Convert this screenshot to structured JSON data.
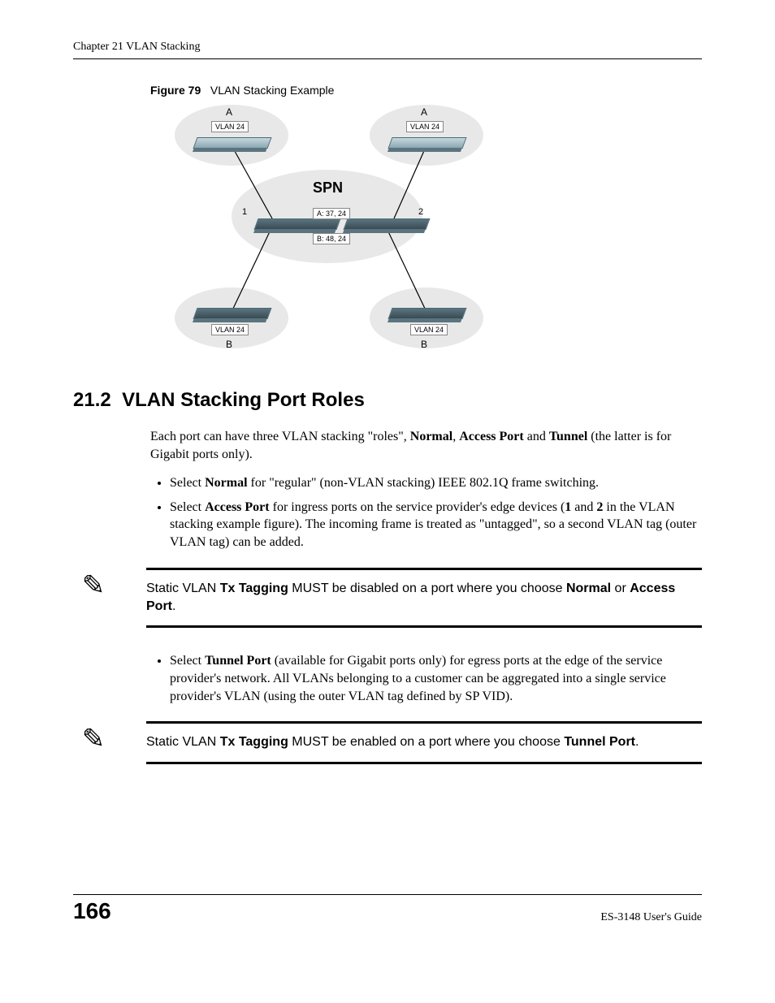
{
  "header": {
    "text": "Chapter 21 VLAN Stacking"
  },
  "figure": {
    "label": "Figure 79",
    "caption": "VLAN Stacking Example",
    "labels": {
      "spn": "SPN",
      "a_left": "A",
      "a_right": "A",
      "b_left": "B",
      "b_right": "B",
      "n1": "1",
      "n2": "2",
      "vlan_tl": "VLAN 24",
      "vlan_tr": "VLAN 24",
      "vlan_bl": "VLAN 24",
      "vlan_br": "VLAN 24",
      "mid_top": "A: 37, 24",
      "mid_bottom": "B: 48, 24"
    }
  },
  "section": {
    "number": "21.2",
    "title": "VLAN Stacking Port Roles",
    "intro_pre": "Each port can have three VLAN stacking \"roles\", ",
    "intro_b1": "Normal",
    "intro_mid1": ", ",
    "intro_b2": "Access Port",
    "intro_mid2": " and ",
    "intro_b3": "Tunnel",
    "intro_post": " (the latter is for Gigabit ports only).",
    "bullets1": {
      "b1_pre": "Select ",
      "b1_b": "Normal",
      "b1_post": " for \"regular\" (non-VLAN stacking) IEEE 802.1Q frame switching.",
      "b2_pre": "Select ",
      "b2_b": "Access Port",
      "b2_mid": " for ingress ports on the service provider's edge devices (",
      "b2_n1": "1",
      "b2_and": " and ",
      "b2_n2": "2",
      "b2_post": " in the VLAN stacking example figure). The incoming frame is treated as \"untagged\", so a second VLAN tag (outer VLAN tag) can be added."
    },
    "note1_pre": "Static VLAN ",
    "note1_b1": "Tx Tagging",
    "note1_mid1": " MUST be disabled on a port where you choose ",
    "note1_b2": "Normal",
    "note1_or": " or ",
    "note1_b3": "Access Port",
    "note1_post": ".",
    "bullets2": {
      "b3_pre": "Select ",
      "b3_b": "Tunnel Port",
      "b3_post": " (available for Gigabit ports only) for egress ports at the edge of the service provider's network. All VLANs belonging to a customer can be aggregated into a single service provider's VLAN (using the outer VLAN tag defined by SP VID)."
    },
    "note2_pre": "Static VLAN ",
    "note2_b1": "Tx Tagging",
    "note2_mid1": " MUST be enabled on a port where you choose ",
    "note2_b2": "Tunnel Port",
    "note2_post": "."
  },
  "footer": {
    "page": "166",
    "guide": "ES-3148 User's Guide"
  },
  "icons": {
    "note": "✎"
  }
}
